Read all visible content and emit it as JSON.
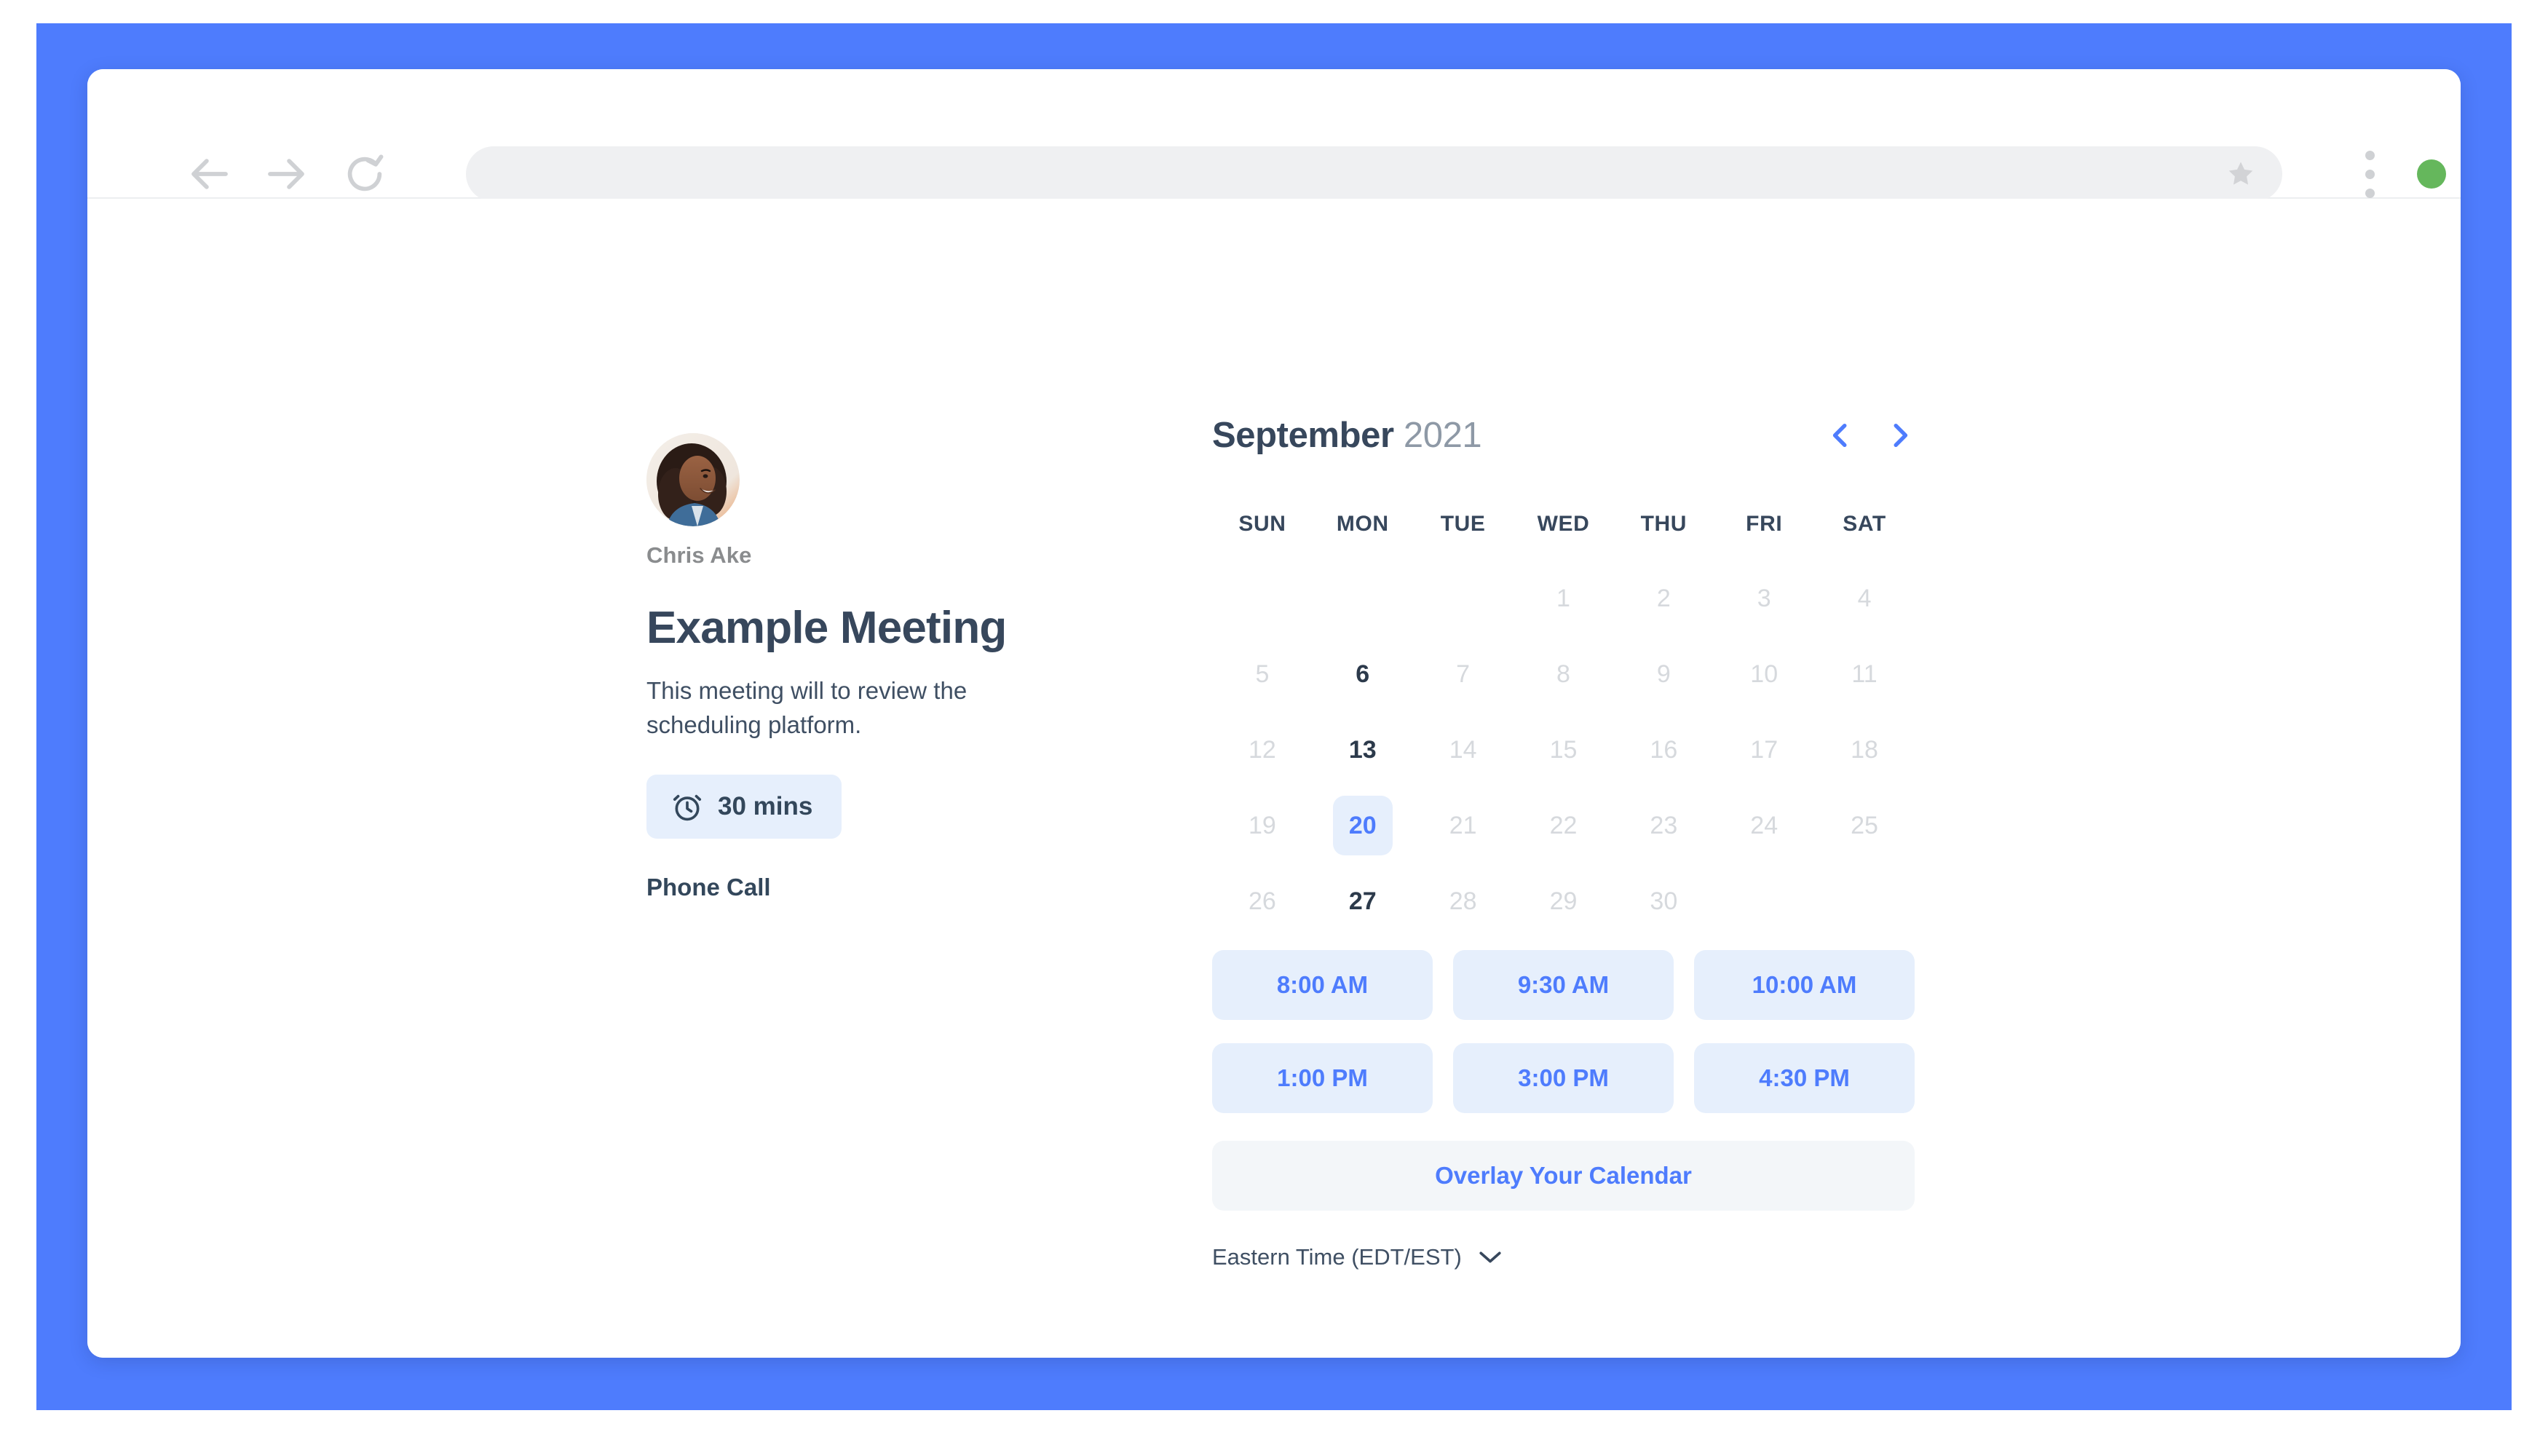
{
  "browser": {
    "back_icon": "arrow-left-icon",
    "forward_icon": "arrow-right-icon",
    "reload_icon": "reload-icon",
    "url_value": "",
    "url_placeholder": "",
    "bookmark_icon": "star-icon",
    "menu_icon": "three-dots-vertical-icon",
    "window_dots": [
      {
        "name": "maximize",
        "color": "#65b75c"
      },
      {
        "name": "minimize",
        "color": "#efb740"
      },
      {
        "name": "close",
        "color": "#e0564f"
      }
    ]
  },
  "meeting": {
    "host_name": "Chris Ake",
    "title": "Example Meeting",
    "description": "This meeting will to review the scheduling platform.",
    "duration_label": "30 mins",
    "duration_icon": "alarm-clock-icon",
    "location": "Phone Call"
  },
  "calendar": {
    "month": "September",
    "year": "2021",
    "prev_icon": "chevron-left-icon",
    "next_icon": "chevron-right-icon",
    "weekdays": [
      "SUN",
      "MON",
      "TUE",
      "WED",
      "THU",
      "FRI",
      "SAT"
    ],
    "leading_blanks": 3,
    "days": [
      {
        "label": "1",
        "state": "disabled"
      },
      {
        "label": "2",
        "state": "disabled"
      },
      {
        "label": "3",
        "state": "disabled"
      },
      {
        "label": "4",
        "state": "disabled"
      },
      {
        "label": "5",
        "state": "disabled"
      },
      {
        "label": "6",
        "state": "available"
      },
      {
        "label": "7",
        "state": "disabled"
      },
      {
        "label": "8",
        "state": "disabled"
      },
      {
        "label": "9",
        "state": "disabled"
      },
      {
        "label": "10",
        "state": "disabled"
      },
      {
        "label": "11",
        "state": "disabled"
      },
      {
        "label": "12",
        "state": "disabled"
      },
      {
        "label": "13",
        "state": "available"
      },
      {
        "label": "14",
        "state": "disabled"
      },
      {
        "label": "15",
        "state": "disabled"
      },
      {
        "label": "16",
        "state": "disabled"
      },
      {
        "label": "17",
        "state": "disabled"
      },
      {
        "label": "18",
        "state": "disabled"
      },
      {
        "label": "19",
        "state": "disabled"
      },
      {
        "label": "20",
        "state": "selected"
      },
      {
        "label": "21",
        "state": "disabled"
      },
      {
        "label": "22",
        "state": "disabled"
      },
      {
        "label": "23",
        "state": "disabled"
      },
      {
        "label": "24",
        "state": "disabled"
      },
      {
        "label": "25",
        "state": "disabled"
      },
      {
        "label": "26",
        "state": "disabled"
      },
      {
        "label": "27",
        "state": "available"
      },
      {
        "label": "28",
        "state": "disabled"
      },
      {
        "label": "29",
        "state": "disabled"
      },
      {
        "label": "30",
        "state": "disabled"
      }
    ],
    "timeslots": [
      "8:00 AM",
      "9:30 AM",
      "10:00 AM",
      "1:00 PM",
      "3:00 PM",
      "4:30 PM"
    ],
    "overlay_button_label": "Overlay Your Calendar",
    "timezone_label": "Eastern Time (EDT/EST)",
    "timezone_chevron_icon": "chevron-down-icon"
  },
  "colors": {
    "backdrop_blue": "#4e7cfd",
    "accent_blue": "#4e7cfd",
    "slot_background": "#e6effc",
    "heading_dark": "#37475c",
    "overlay_background": "#f3f6f9"
  }
}
